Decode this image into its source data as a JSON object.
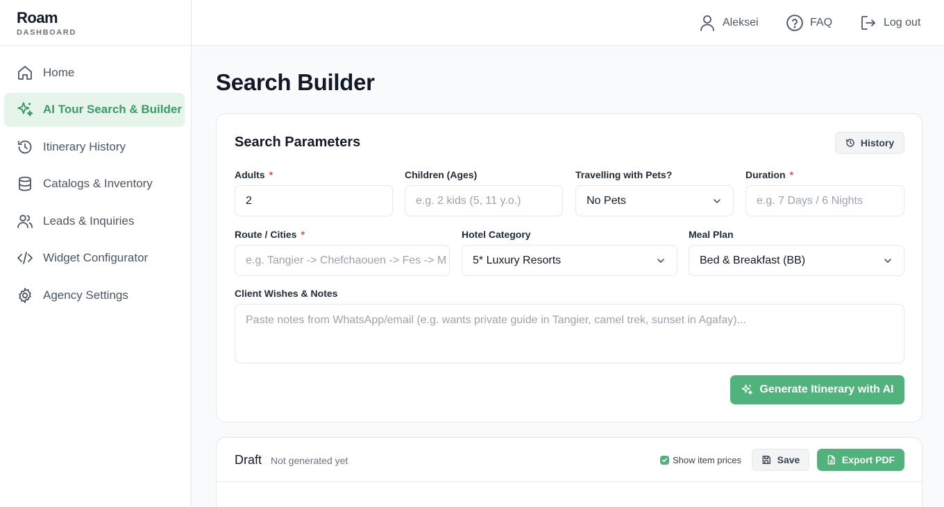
{
  "brand": {
    "name": "Roam",
    "subtitle": "DASHBOARD"
  },
  "sidebar": {
    "items": [
      {
        "label": "Home",
        "icon": "home-icon",
        "active": false
      },
      {
        "label": "AI Tour Search & Builder",
        "icon": "sparkles-icon",
        "active": true
      },
      {
        "label": "Itinerary History",
        "icon": "history-icon",
        "active": false
      },
      {
        "label": "Catalogs & Inventory",
        "icon": "database-icon",
        "active": false
      },
      {
        "label": "Leads & Inquiries",
        "icon": "users-icon",
        "active": false
      },
      {
        "label": "Widget Configurator",
        "icon": "code-icon",
        "active": false
      },
      {
        "label": "Agency Settings",
        "icon": "gear-icon",
        "active": false
      }
    ]
  },
  "topbar": {
    "user": "Aleksei",
    "faq": "FAQ",
    "logout": "Log out"
  },
  "page": {
    "title": "Search Builder"
  },
  "params": {
    "title": "Search Parameters",
    "history_label": "History",
    "adults": {
      "label": "Adults",
      "value": "2"
    },
    "children": {
      "label": "Children (Ages)",
      "placeholder": "e.g. 2 kids (5, 11 y.o.)"
    },
    "pets": {
      "label": "Travelling with Pets?",
      "value": "No Pets"
    },
    "duration": {
      "label": "Duration",
      "placeholder": "e.g. 7 Days / 6 Nights"
    },
    "route": {
      "label": "Route / Cities",
      "placeholder": "e.g. Tangier -> Chefchaouen -> Fes -> M"
    },
    "hotel": {
      "label": "Hotel Category",
      "value": "5* Luxury Resorts"
    },
    "meal": {
      "label": "Meal Plan",
      "value": "Bed & Breakfast (BB)"
    },
    "notes": {
      "label": "Client Wishes & Notes",
      "placeholder": "Paste notes from WhatsApp/email (e.g. wants private guide in Tangier, camel trek, sunset in Agafay)..."
    },
    "required_mark": "*",
    "generate_label": "Generate Itinerary with AI"
  },
  "draft": {
    "title": "Draft",
    "status": "Not generated yet",
    "show_prices_label": "Show item prices",
    "show_prices_checked": true,
    "save_label": "Save",
    "export_label": "Export PDF"
  },
  "colors": {
    "accent": "#52b27c",
    "accent_text": "#3d9a64",
    "active_bg": "#e6f4ec",
    "required": "#ef4444"
  }
}
